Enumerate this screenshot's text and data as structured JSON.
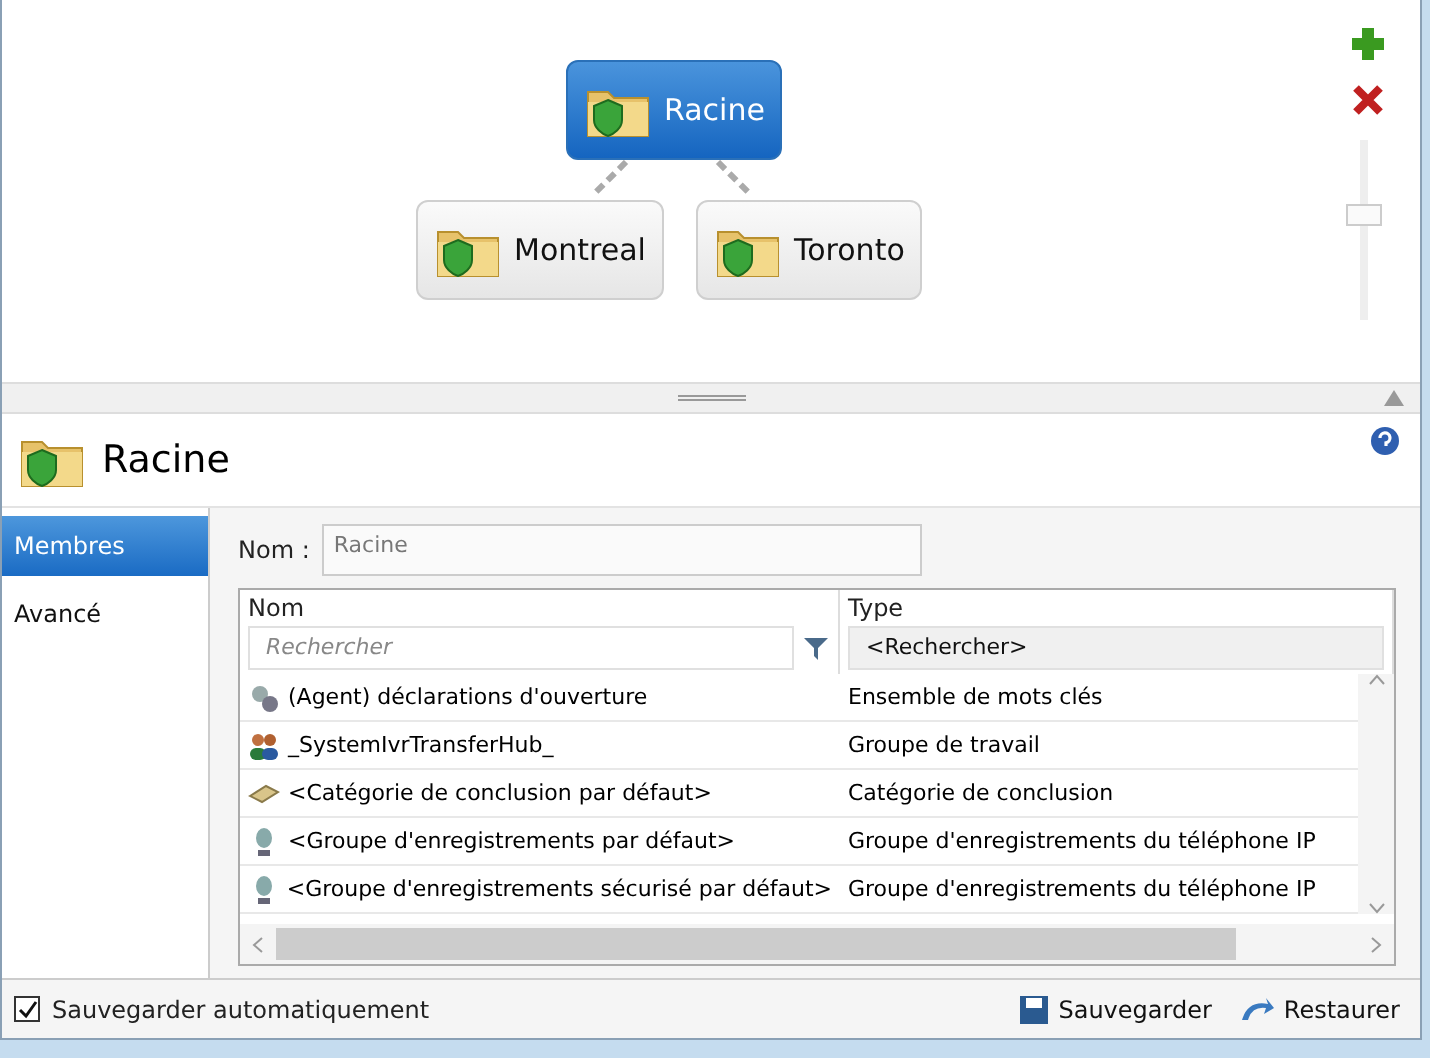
{
  "diagram": {
    "nodes": [
      {
        "label": "Racine",
        "selected": true
      },
      {
        "label": "Montreal",
        "selected": false
      },
      {
        "label": "Toronto",
        "selected": false
      }
    ],
    "zoom": {
      "level": 0.6
    }
  },
  "header": {
    "title": "Racine"
  },
  "nav": [
    {
      "label": "Membres",
      "selected": true
    },
    {
      "label": "Avancé",
      "selected": false
    }
  ],
  "name_field": {
    "label": "Nom :",
    "value": "Racine"
  },
  "table": {
    "columns": [
      {
        "label": "Nom",
        "filter_placeholder": "Rechercher"
      },
      {
        "label": "Type",
        "filter_value": "<Rechercher>"
      }
    ],
    "rows": [
      {
        "kind": "keywords",
        "name": "(Agent) déclarations d'ouverture",
        "type": "Ensemble de mots clés"
      },
      {
        "kind": "workgroup",
        "name": "_SystemIvrTransferHub_",
        "type": "Groupe de travail"
      },
      {
        "kind": "category",
        "name": "<Catégorie de conclusion par défaut>",
        "type": "Catégorie de conclusion"
      },
      {
        "kind": "station",
        "name": "<Groupe d'enregistrements par défaut>",
        "type": "Groupe d'enregistrements du téléphone IP"
      },
      {
        "kind": "station",
        "name": "<Groupe d'enregistrements sécurisé par défaut>",
        "type": "Groupe d'enregistrements du téléphone IP"
      }
    ]
  },
  "footer": {
    "autosave": {
      "label": "Sauvegarder automatiquement",
      "checked": true
    },
    "buttons": [
      {
        "kind": "save",
        "label": "Sauvegarder"
      },
      {
        "kind": "restore",
        "label": "Restaurer"
      }
    ]
  }
}
